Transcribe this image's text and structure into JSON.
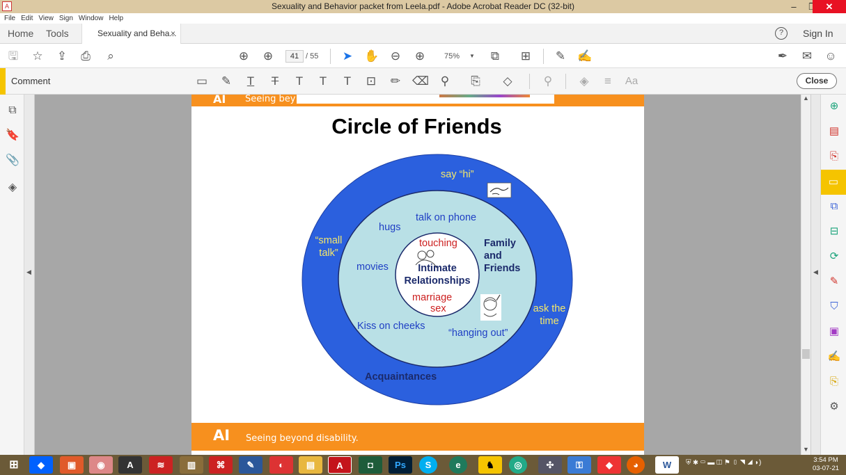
{
  "window": {
    "title": "Sexuality and Behavior packet from Leela.pdf - Adobe Acrobat Reader DC (32-bit)",
    "controls": {
      "minimize": "–",
      "restore": "❐",
      "close": "✕"
    }
  },
  "menu": [
    "File",
    "Edit",
    "View",
    "Sign",
    "Window",
    "Help"
  ],
  "tabs": {
    "home": "Home",
    "tools": "Tools",
    "document": "Sexuality and Beha...",
    "close": "×",
    "help": "?",
    "sign_in": "Sign In"
  },
  "toolbar": {
    "page_current": "41",
    "page_total": "/ 55",
    "zoom": "75%"
  },
  "comment_bar": {
    "label": "Comment",
    "close": "Close",
    "text_size_label": "Aa"
  },
  "document": {
    "header_logo": "AI",
    "header_tagline": "Seeing bey",
    "footer_logo": "AI",
    "footer_tagline": "Seeing beyond disability.",
    "slide_title": "Circle of Friends",
    "outer_ring": {
      "say_hi": "say “hi”",
      "small_talk": "“small talk”",
      "ask_time": "ask the time",
      "label": "Acquaintances"
    },
    "middle_ring": {
      "hugs": "hugs",
      "talk_on_phone": "talk on phone",
      "movies": "movies",
      "family_friends": "Family and Friends",
      "kiss": "Kiss on cheeks",
      "hanging_out": "“hanging out”"
    },
    "inner_circle": {
      "touching": "touching",
      "label": "Intimate Relationships",
      "marriage": "marriage",
      "sex": "sex"
    },
    "colors": {
      "outer": "#2b60de",
      "middle": "#b9e0e6",
      "inner": "#ffffff",
      "yellow_text": "#f5e86a",
      "blue_text": "#1f3fc4",
      "red_text": "#cc1f1f",
      "navy_text": "#1b2a6b",
      "orange_band": "#f7901e"
    }
  },
  "taskbar": {
    "clock_time": "3:54 PM",
    "clock_date": "03-07-21"
  }
}
